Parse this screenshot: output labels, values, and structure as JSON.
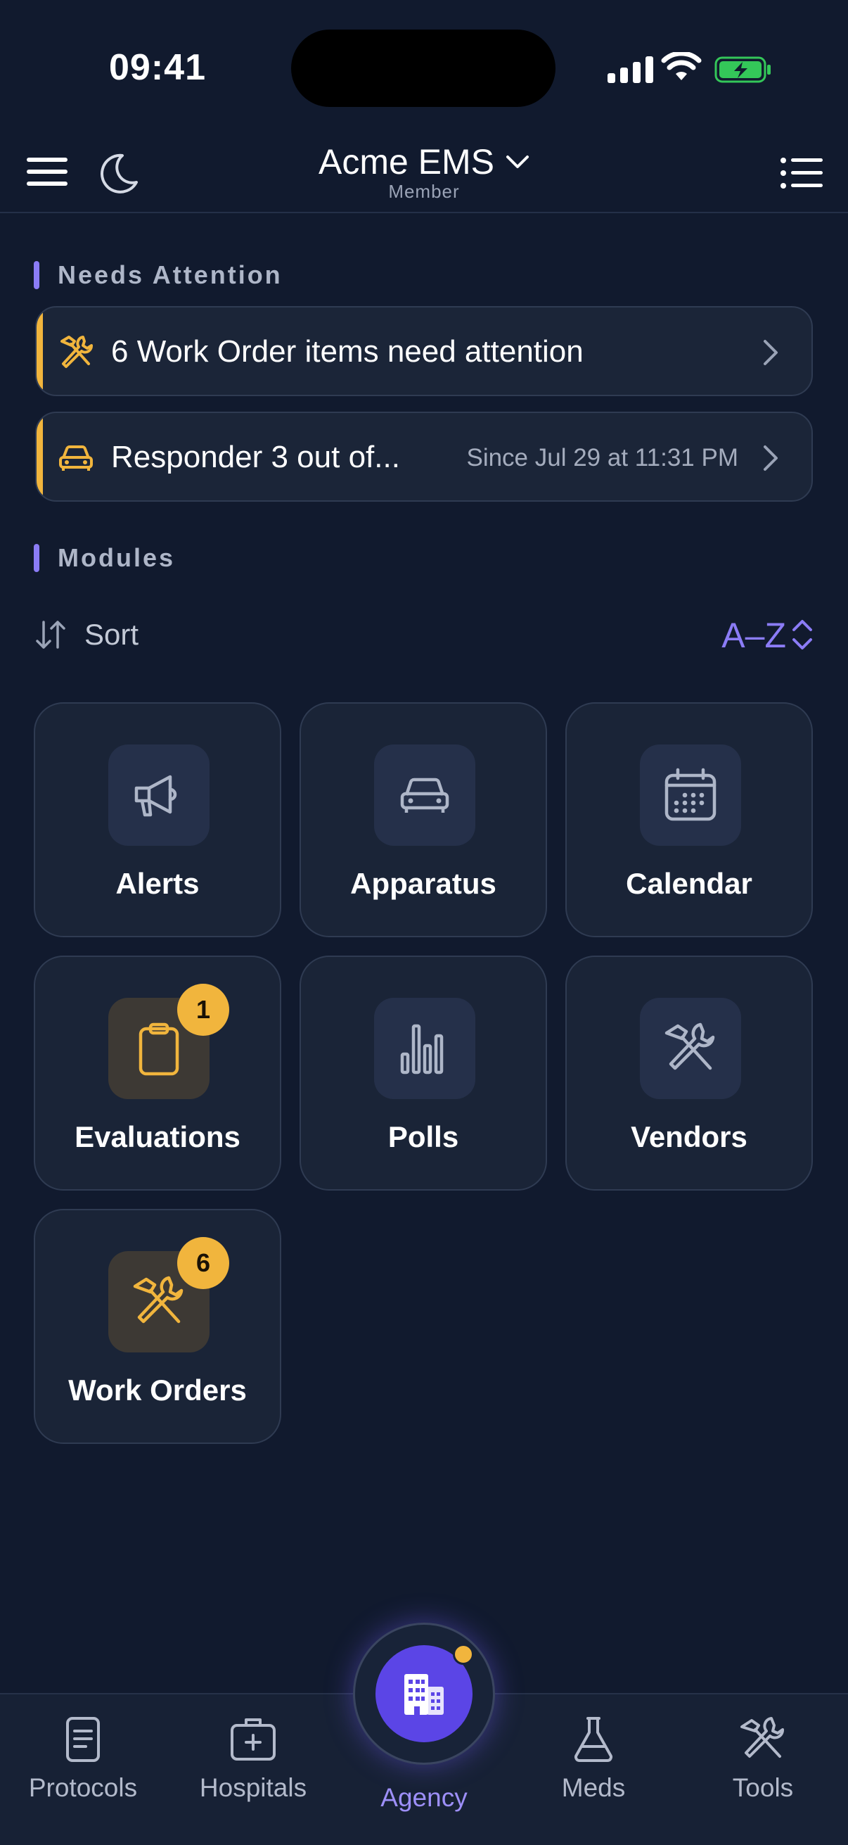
{
  "status_bar": {
    "time": "09:41"
  },
  "header": {
    "agency_name": "Acme EMS",
    "role": "Member"
  },
  "needs_attention": {
    "title": "Needs Attention",
    "items": [
      {
        "label": "6 Work Order items need attention",
        "meta": "",
        "icon": "hammer-wrench-icon"
      },
      {
        "label": "Responder 3 out of...",
        "meta": "Since Jul 29 at 11:31 PM",
        "icon": "car-icon"
      }
    ]
  },
  "modules": {
    "title": "Modules",
    "sort_label": "Sort",
    "sort_value": "A–Z",
    "items": [
      {
        "label": "Alerts",
        "icon": "megaphone-icon",
        "badge": null
      },
      {
        "label": "Apparatus",
        "icon": "car-icon",
        "badge": null
      },
      {
        "label": "Calendar",
        "icon": "calendar-icon",
        "badge": null
      },
      {
        "label": "Evaluations",
        "icon": "clipboard-icon",
        "badge": "1"
      },
      {
        "label": "Polls",
        "icon": "bar-chart-icon",
        "badge": null
      },
      {
        "label": "Vendors",
        "icon": "hammer-wrench-icon",
        "badge": null
      },
      {
        "label": "Work Orders",
        "icon": "hammer-wrench-icon",
        "badge": "6"
      }
    ]
  },
  "tabbar": {
    "items": [
      {
        "label": "Protocols",
        "icon": "document-icon"
      },
      {
        "label": "Hospitals",
        "icon": "medical-kit-icon"
      },
      {
        "label": "Agency",
        "icon": "building-icon",
        "active": true
      },
      {
        "label": "Meds",
        "icon": "flask-icon"
      },
      {
        "label": "Tools",
        "icon": "hammer-wrench-icon"
      }
    ]
  },
  "colors": {
    "background": "#111a2e",
    "accent": "#8b7cf6",
    "warning": "#f1b53d",
    "card": "#1b2538"
  }
}
